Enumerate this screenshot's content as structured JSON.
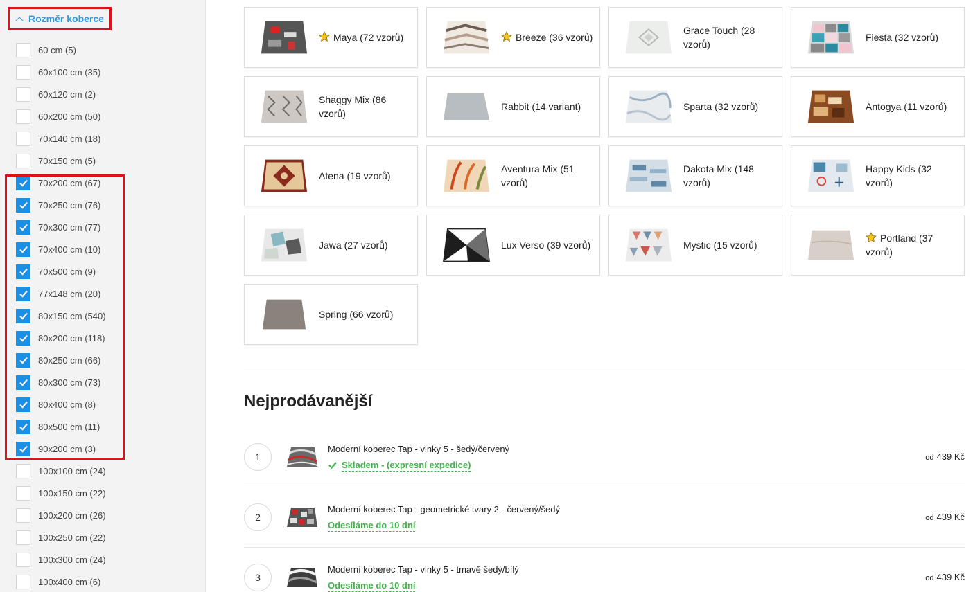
{
  "filter": {
    "title": "Rozměr koberce",
    "options": [
      {
        "label": "60 cm (5)",
        "checked": false
      },
      {
        "label": "60x100 cm (35)",
        "checked": false
      },
      {
        "label": "60x120 cm (2)",
        "checked": false
      },
      {
        "label": "60x200 cm (50)",
        "checked": false
      },
      {
        "label": "70x140 cm (18)",
        "checked": false
      },
      {
        "label": "70x150 cm (5)",
        "checked": false
      },
      {
        "label": "70x200 cm (67)",
        "checked": true
      },
      {
        "label": "70x250 cm (76)",
        "checked": true
      },
      {
        "label": "70x300 cm (77)",
        "checked": true
      },
      {
        "label": "70x400 cm (10)",
        "checked": true
      },
      {
        "label": "70x500 cm (9)",
        "checked": true
      },
      {
        "label": "77x148 cm (20)",
        "checked": true
      },
      {
        "label": "80x150 cm (540)",
        "checked": true
      },
      {
        "label": "80x200 cm (118)",
        "checked": true
      },
      {
        "label": "80x250 cm (66)",
        "checked": true
      },
      {
        "label": "80x300 cm (73)",
        "checked": true
      },
      {
        "label": "80x400 cm (8)",
        "checked": true
      },
      {
        "label": "80x500 cm (11)",
        "checked": true
      },
      {
        "label": "90x200 cm (3)",
        "checked": true
      },
      {
        "label": "100x100 cm (24)",
        "checked": false
      },
      {
        "label": "100x150 cm (22)",
        "checked": false
      },
      {
        "label": "100x200 cm (26)",
        "checked": false
      },
      {
        "label": "100x250 cm (22)",
        "checked": false
      },
      {
        "label": "100x300 cm (24)",
        "checked": false
      },
      {
        "label": "100x400 cm (6)",
        "checked": false
      }
    ]
  },
  "collections": [
    {
      "label": "Maya (72 vzorů)",
      "star": true
    },
    {
      "label": "Breeze (36 vzorů)",
      "star": true
    },
    {
      "label": "Grace Touch (28 vzorů)",
      "star": false
    },
    {
      "label": "Fiesta (32 vzorů)",
      "star": false
    },
    {
      "label": "Shaggy Mix (86 vzorů)",
      "star": false
    },
    {
      "label": "Rabbit (14 variant)",
      "star": false
    },
    {
      "label": "Sparta (32 vzorů)",
      "star": false
    },
    {
      "label": "Antogya (11 vzorů)",
      "star": false
    },
    {
      "label": "Atena (19 vzorů)",
      "star": false
    },
    {
      "label": "Aventura Mix (51 vzorů)",
      "star": false
    },
    {
      "label": "Dakota Mix (148 vzorů)",
      "star": false
    },
    {
      "label": "Happy Kids (32 vzorů)",
      "star": false
    },
    {
      "label": "Jawa (27 vzorů)",
      "star": false
    },
    {
      "label": "Lux Verso (39 vzorů)",
      "star": false
    },
    {
      "label": "Mystic (15 vzorů)",
      "star": false
    },
    {
      "label": "Portland (37 vzorů)",
      "star": true
    },
    {
      "label": "Spring (66 vzorů)",
      "star": false
    }
  ],
  "bestsellers": {
    "title": "Nejprodávanější",
    "items": [
      {
        "rank": "1",
        "name": "Moderní koberec Tap - vlnky 5 - šedý/červený",
        "stock": "Skladem - (expresní expedice)",
        "in_stock": true,
        "price_prefix": "od",
        "price": "439 Kč"
      },
      {
        "rank": "2",
        "name": "Moderní koberec Tap - geometrické tvary 2 - červený/šedý",
        "stock": "Odesíláme do 10 dní",
        "in_stock": false,
        "price_prefix": "od",
        "price": "439 Kč"
      },
      {
        "rank": "3",
        "name": "Moderní koberec Tap - vlnky 5 - tmavě šedý/bílý",
        "stock": "Odesíláme do 10 dní",
        "in_stock": false,
        "price_prefix": "od",
        "price": "439 Kč"
      }
    ]
  },
  "colors": {
    "accent": "#2b9be0",
    "checkbox": "#1a8fe3",
    "highlight": "#e0101a",
    "stock_green": "#42b34a",
    "star": "#f5c518"
  }
}
